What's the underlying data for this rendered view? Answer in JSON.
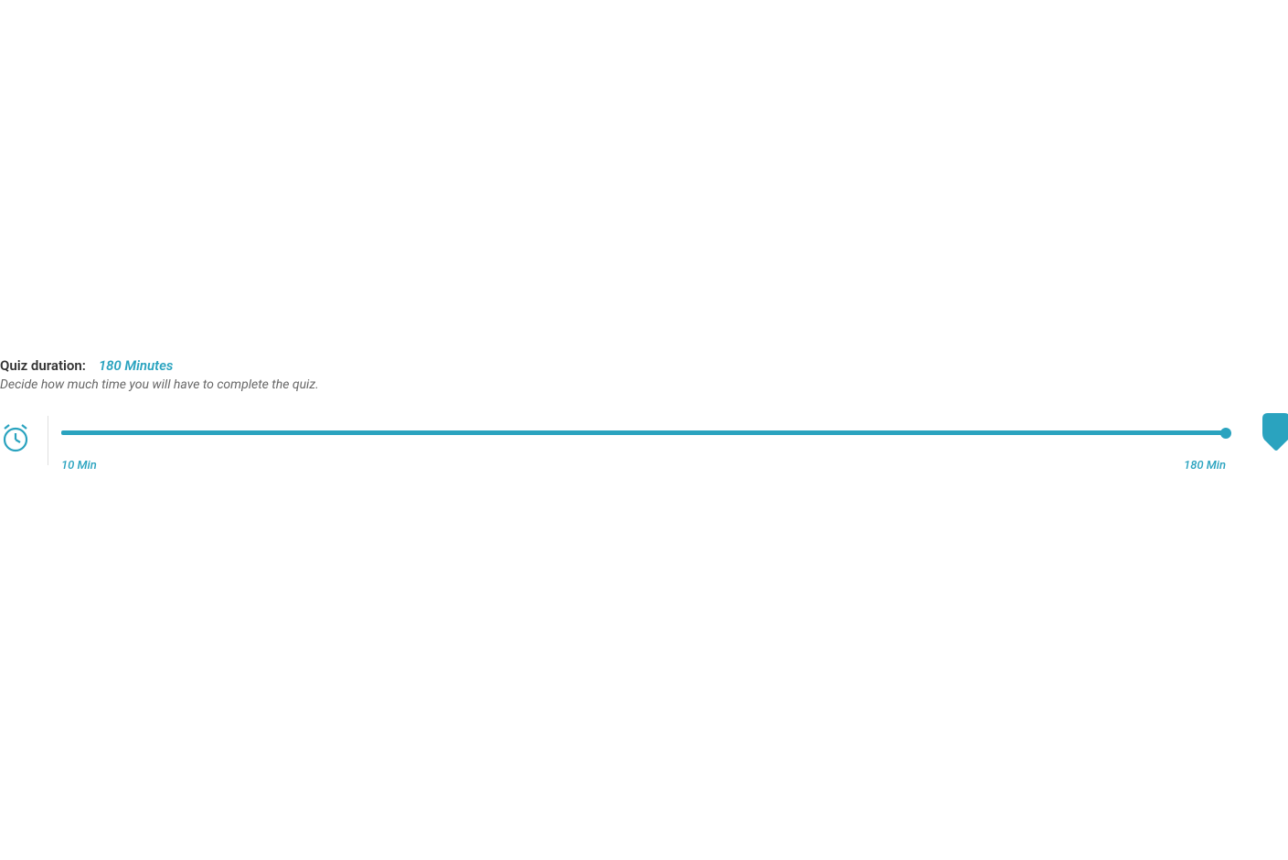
{
  "duration": {
    "label": "Quiz duration:",
    "value": "180 Minutes",
    "description": "Decide how much time you will have to complete the quiz.",
    "min_label": "10 Min",
    "max_label": "180 Min"
  },
  "colors": {
    "accent": "#2aa3bf"
  }
}
